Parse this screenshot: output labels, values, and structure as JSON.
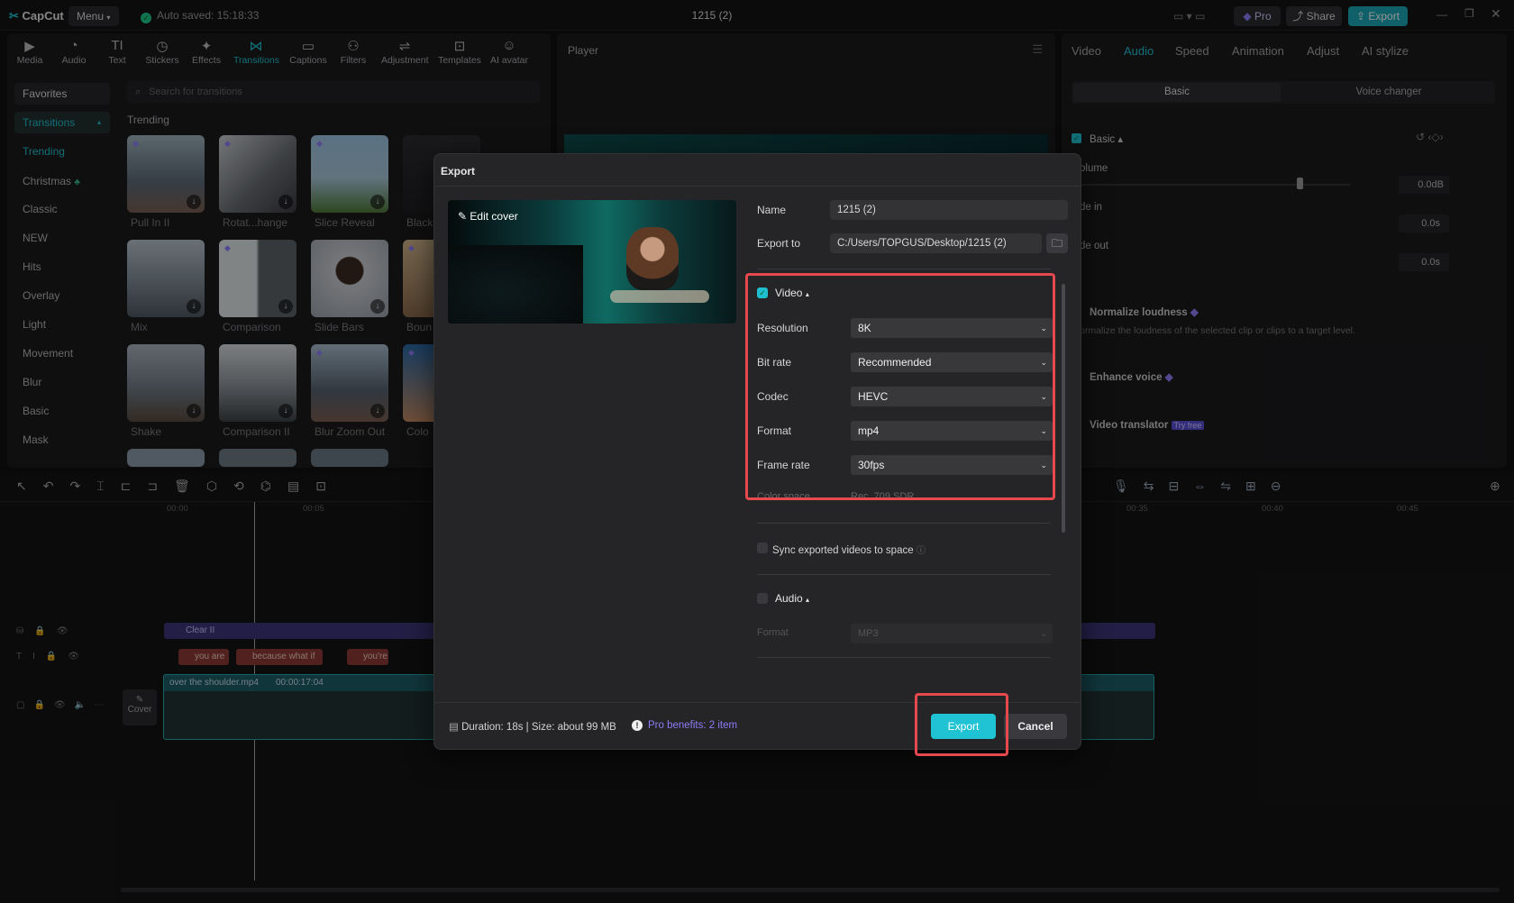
{
  "app": {
    "logo": "CapCut",
    "menu_label": "Menu",
    "autosave": "Auto saved: 15:18:33",
    "project_title": "1215 (2)",
    "pro_label": "Pro",
    "share_label": "Share",
    "export_label": "Export"
  },
  "toolbar": {
    "tools": [
      {
        "label": "Media",
        "icon": "media-icon",
        "glyph": "▶"
      },
      {
        "label": "Audio",
        "icon": "audio-icon",
        "glyph": "◔"
      },
      {
        "label": "Text",
        "icon": "text-icon",
        "glyph": "TI"
      },
      {
        "label": "Stickers",
        "icon": "stickers-icon",
        "glyph": "◷"
      },
      {
        "label": "Effects",
        "icon": "effects-icon",
        "glyph": "✦"
      },
      {
        "label": "Transitions",
        "icon": "transitions-icon",
        "glyph": "⋈"
      },
      {
        "label": "Captions",
        "icon": "captions-icon",
        "glyph": "▭"
      },
      {
        "label": "Filters",
        "icon": "filters-icon",
        "glyph": "⚇"
      },
      {
        "label": "Adjustment",
        "icon": "adjustment-icon",
        "glyph": "⇌"
      },
      {
        "label": "Templates",
        "icon": "templates-icon",
        "glyph": "⊡"
      },
      {
        "label": "AI avatar",
        "icon": "ai-avatar-icon",
        "glyph": "☺"
      }
    ]
  },
  "sidebar": {
    "favorites": "Favorites",
    "transitions": "Transitions",
    "items": [
      "Trending",
      "Christmas",
      "Classic",
      "NEW",
      "Hits",
      "Overlay",
      "Light",
      "Movement",
      "Blur",
      "Basic",
      "Mask"
    ]
  },
  "library": {
    "search_placeholder": "Search for transitions",
    "section": "Trending",
    "items": [
      "Pull In II",
      "Rotat...hange",
      "Slice Reveal",
      "Black",
      "Mix",
      "Comparison",
      "Slide Bars",
      "Boun",
      "Shake",
      "Comparison II",
      "Blur Zoom Out",
      "Colo"
    ]
  },
  "player": {
    "title": "Player"
  },
  "right_panel": {
    "tabs": [
      "Video",
      "Audio",
      "Speed",
      "Animation",
      "Adjust",
      "AI stylize"
    ],
    "subtabs": [
      "Basic",
      "Voice changer"
    ],
    "basic_label": "Basic",
    "volume": "olume",
    "volume_value": "0.0dB",
    "fade_in": "de in",
    "fade_in_value": "0.0s",
    "fade_out": "de out",
    "fade_out_value": "0.0s",
    "normalize": "Normalize loudness",
    "normalize_desc": "ormalize the loudness of the selected clip or clips to a target level.",
    "enhance": "Enhance voice",
    "translator": "Video translator",
    "try_free": "Try free"
  },
  "timeline": {
    "ticks": [
      "00:00",
      "00:05",
      "00:35",
      "00:40",
      "00:45"
    ],
    "effect_clip": "Clear II",
    "text_clips": [
      "you are",
      "because what if",
      "you're"
    ],
    "video_clip_name": "over the shoulder.mp4",
    "video_clip_duration": "00:00:17:04",
    "cover_label": "Cover"
  },
  "export_dialog": {
    "title": "Export",
    "edit_cover": "Edit cover",
    "name_label": "Name",
    "name_value": "1215 (2)",
    "export_to_label": "Export to",
    "export_to_value": "C:/Users/TOPGUS/Desktop/1215 (2)",
    "video_section": "Video",
    "video_checked": true,
    "settings": [
      {
        "label": "Resolution",
        "value": "8K"
      },
      {
        "label": "Bit rate",
        "value": "Recommended"
      },
      {
        "label": "Codec",
        "value": "HEVC"
      },
      {
        "label": "Format",
        "value": "mp4"
      },
      {
        "label": "Frame rate",
        "value": "30fps"
      }
    ],
    "color_space_label": "Color space",
    "color_space_value": "Rec. 709 SDR",
    "sync_label": "Sync exported videos to space",
    "audio_section": "Audio",
    "audio_format_label": "Format",
    "audio_format_value": "MP3",
    "duration_size": "Duration: 18s | Size: about 99 MB",
    "pro_benefits": "Pro benefits: 2 item",
    "export_button": "Export",
    "cancel_button": "Cancel"
  },
  "colors": {
    "accent": "#20bfd0",
    "highlight": "#e5484d",
    "pro": "#7b6cf6"
  }
}
